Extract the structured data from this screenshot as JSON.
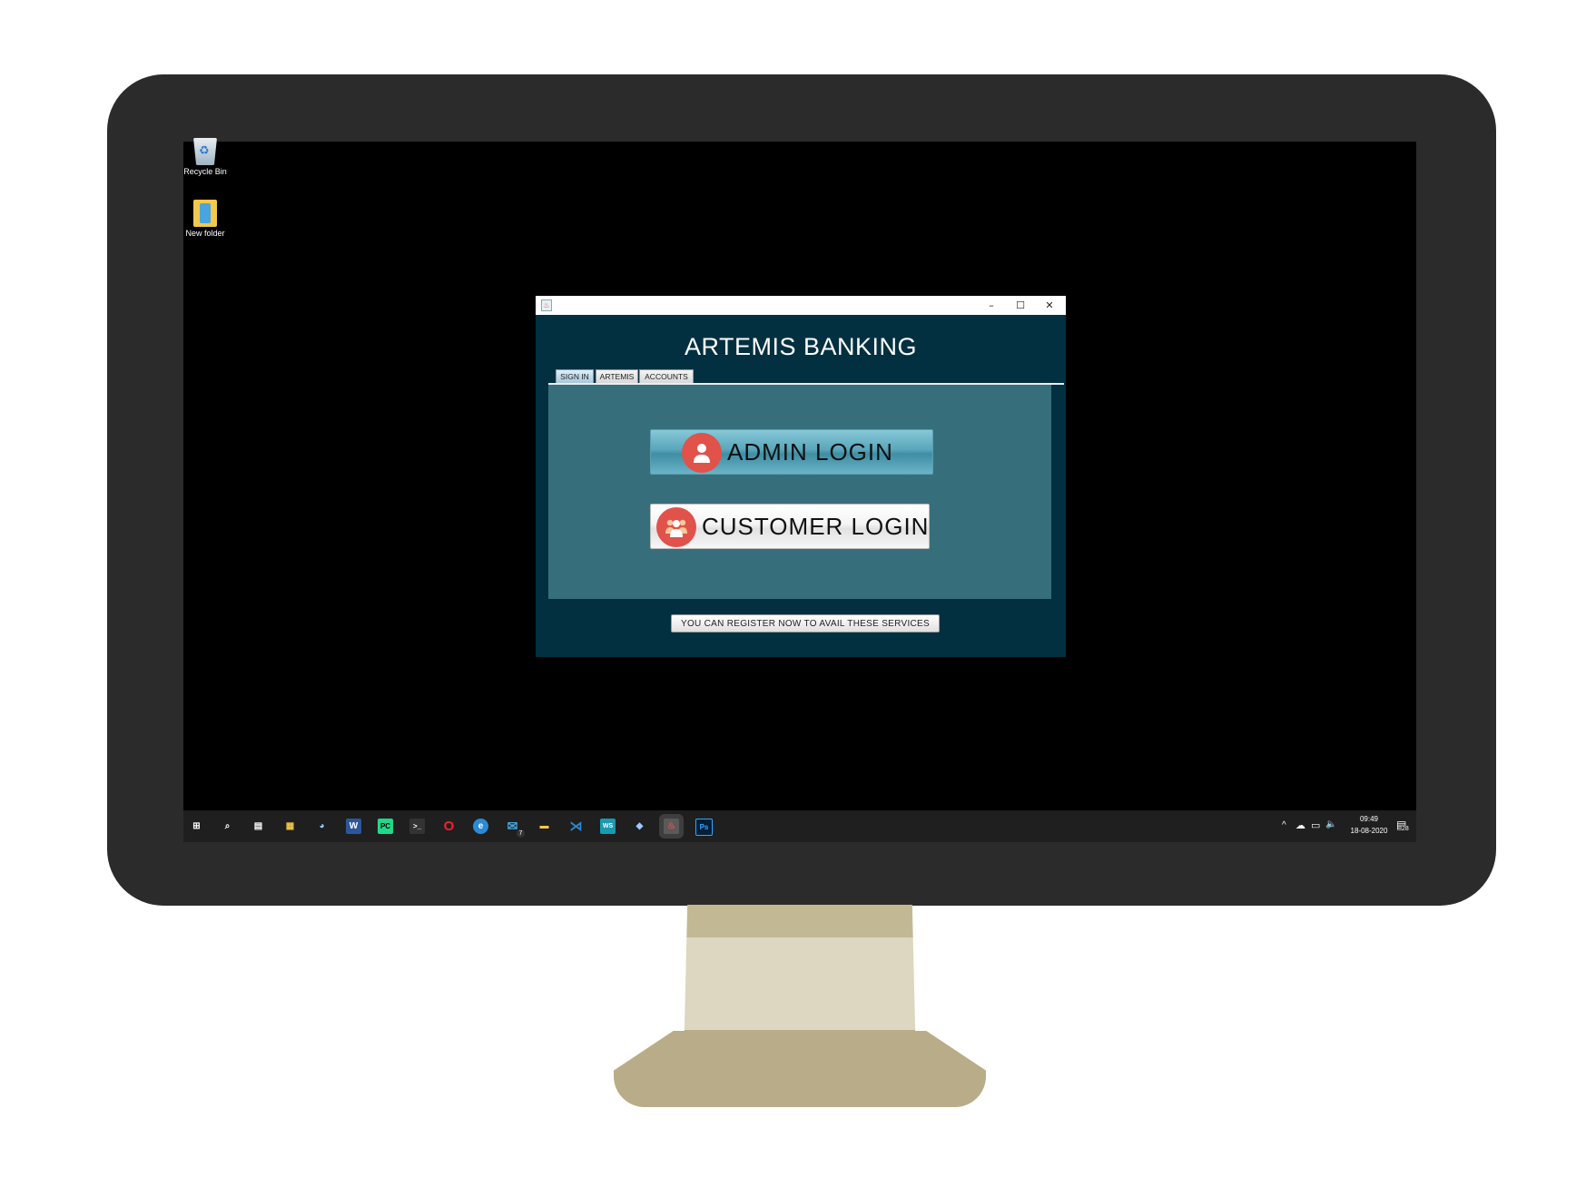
{
  "desktop": {
    "icons": [
      {
        "label": "Recycle Bin",
        "icon": "recycle-bin-icon"
      },
      {
        "label": "New folder",
        "icon": "folder-icon"
      }
    ]
  },
  "window": {
    "controls": {
      "minimize": "–",
      "maximize": "☐",
      "close": "✕"
    }
  },
  "app": {
    "title": "ARTEMIS BANKING",
    "tabs": [
      {
        "label": "SIGN IN",
        "active": true
      },
      {
        "label": "ARTEMIS",
        "active": false
      },
      {
        "label": "ACCOUNTS",
        "active": false
      }
    ],
    "admin_login": "ADMIN LOGIN",
    "customer_login": "CUSTOMER LOGIN",
    "register": "YOU CAN REGISTER NOW TO AVAIL THESE SERVICES"
  },
  "taskbar": {
    "apps": [
      {
        "name": "start-icon",
        "glyph": "⊞"
      },
      {
        "name": "search-icon",
        "glyph": "⌕"
      },
      {
        "name": "task-view-icon",
        "glyph": "▤"
      },
      {
        "name": "store-icon",
        "glyph": "▦"
      },
      {
        "name": "paint-icon",
        "glyph": "◕"
      },
      {
        "name": "word-icon",
        "glyph": "W"
      },
      {
        "name": "pycharm-icon",
        "glyph": "PC"
      },
      {
        "name": "terminal-icon",
        "glyph": ">_"
      },
      {
        "name": "opera-icon",
        "glyph": "O"
      },
      {
        "name": "edge-icon",
        "glyph": "e"
      },
      {
        "name": "mail-icon",
        "glyph": "✉"
      },
      {
        "name": "file-explorer-icon",
        "glyph": "▬"
      },
      {
        "name": "vscode-icon",
        "glyph": "⋊"
      },
      {
        "name": "webstorm-icon",
        "glyph": "WS"
      },
      {
        "name": "virtualbox-icon",
        "glyph": "◆"
      },
      {
        "name": "java-app-icon",
        "glyph": "♨"
      },
      {
        "name": "photoshop-icon",
        "glyph": "Ps"
      }
    ],
    "mail_badge": "7",
    "tray": {
      "chevron": "^",
      "cloud": "☁",
      "network": "▭",
      "volume": "🔈"
    },
    "time": "09:49",
    "date": "18-08-2020",
    "notifications": "28"
  },
  "colors": {
    "window_bg": "#023040",
    "panel_bg": "#366f7b",
    "accent_red": "#e0524a"
  }
}
